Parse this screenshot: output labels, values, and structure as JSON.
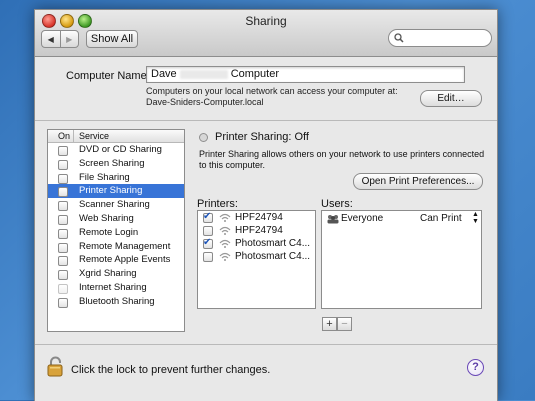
{
  "window": {
    "title": "Sharing",
    "show_all_label": "Show All",
    "search_placeholder": ""
  },
  "computer_name": {
    "label": "Computer Name:",
    "value_part1": "Dave",
    "value_part2": "Computer",
    "description": "Computers on your local network can access your computer at: Dave-Sniders-Computer.local",
    "edit_button": "Edit…"
  },
  "services": {
    "header_on": "On",
    "header_service": "Service",
    "items": [
      {
        "label": "DVD or CD Sharing"
      },
      {
        "label": "Screen Sharing"
      },
      {
        "label": "File Sharing"
      },
      {
        "label": "Printer Sharing",
        "selected": true
      },
      {
        "label": "Scanner Sharing"
      },
      {
        "label": "Web Sharing"
      },
      {
        "label": "Remote Login"
      },
      {
        "label": "Remote Management"
      },
      {
        "label": "Remote Apple Events"
      },
      {
        "label": "Xgrid Sharing"
      },
      {
        "label": "Internet Sharing",
        "dimmed": true
      },
      {
        "label": "Bluetooth Sharing"
      }
    ]
  },
  "printer_sharing": {
    "status": "Printer Sharing: Off",
    "description": "Printer Sharing allows others on your network to use printers connected to this computer.",
    "open_print_prefs_button": "Open Print Preferences...",
    "printers_label": "Printers:",
    "users_label": "Users:",
    "printers": [
      {
        "name": "HPF24794",
        "checked": true
      },
      {
        "name": "HPF24794",
        "checked": false
      },
      {
        "name": "Photosmart C4...",
        "checked": true
      },
      {
        "name": "Photosmart C4...",
        "checked": false
      }
    ],
    "users": [
      {
        "name": "Everyone",
        "permission": "Can Print"
      }
    ],
    "add_label": "+",
    "remove_label": "−"
  },
  "footer": {
    "lock_text": "Click the lock to prevent further changes.",
    "help_label": "?"
  }
}
